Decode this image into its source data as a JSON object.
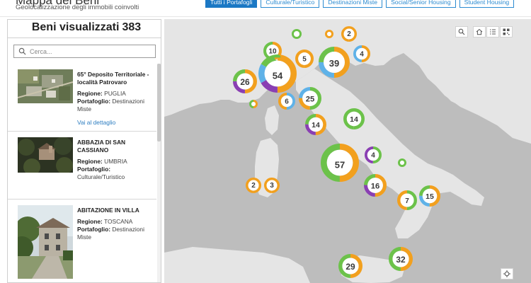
{
  "header": {
    "title": "Mappa dei Beni",
    "subtitle": "Geolocalizzazione degli immobili coinvolti"
  },
  "tabs": [
    {
      "label": "Tutti i Portafogli",
      "active": true
    },
    {
      "label": "Culturale/Turistico",
      "active": false
    },
    {
      "label": "Destinazioni Miste",
      "active": false
    },
    {
      "label": "Social/Senior Housing",
      "active": false
    },
    {
      "label": "Student Housing",
      "active": false
    }
  ],
  "sidebar": {
    "count_label": "Beni visualizzati",
    "count_value": "383",
    "search_placeholder": "Cerca...",
    "items": [
      {
        "title": "65° Deposito Territoriale - località Patrovaro",
        "region_label": "Regione:",
        "region_value": "PUGLIA",
        "portfolio_label": "Portafoglio:",
        "portfolio_value": "Destinazioni Miste",
        "link": "Vai al dettaglio"
      },
      {
        "title": "ABBAZIA DI SAN CASSIANO",
        "region_label": "Regione:",
        "region_value": "UMBRIA",
        "portfolio_label": "Portafoglio:",
        "portfolio_value": "Culturale/Turistico"
      },
      {
        "title": "ABITAZIONE IN VILLA",
        "region_label": "Regione:",
        "region_value": "TOSCANA",
        "portfolio_label": "Portafoglio:",
        "portfolio_value": "Destinazioni Miste"
      }
    ]
  },
  "map": {
    "clusters": [
      {
        "label": "10",
        "colors": [
          "#f2a01e",
          "#6cc24a"
        ]
      },
      {
        "label": "54",
        "colors": [
          "#f2a01e",
          "#8a3fb3",
          "#5fb2e8",
          "#6cc24a"
        ]
      },
      {
        "label": "5",
        "colors": [
          "#f2a01e",
          "#f2a01e"
        ]
      },
      {
        "label": "39",
        "colors": [
          "#f2a01e",
          "#5fb2e8",
          "#6cc24a"
        ]
      },
      {
        "label": "4",
        "colors": [
          "#f2a01e",
          "#5fb2e8"
        ]
      },
      {
        "label": "2",
        "colors": [
          "#f2a01e",
          "#f2a01e"
        ]
      },
      {
        "label": "26",
        "colors": [
          "#f2a01e",
          "#8a3fb3",
          "#6cc24a"
        ]
      },
      {
        "label": "6",
        "colors": [
          "#5fb2e8",
          "#f2a01e"
        ]
      },
      {
        "label": "25",
        "colors": [
          "#6cc24a",
          "#f2a01e",
          "#5fb2e8"
        ]
      },
      {
        "label": "14",
        "colors": [
          "#f2a01e",
          "#8a3fb3",
          "#6cc24a"
        ]
      },
      {
        "label": "14",
        "colors": [
          "#6cc24a",
          "#6cc24a"
        ]
      },
      {
        "label": "57",
        "colors": [
          "#f2a01e",
          "#6cc24a"
        ]
      },
      {
        "label": "4",
        "colors": [
          "#6cc24a",
          "#8a3fb3"
        ]
      },
      {
        "label": "16",
        "colors": [
          "#f2a01e",
          "#8a3fb3",
          "#6cc24a"
        ]
      },
      {
        "label": "2",
        "colors": [
          "#f2a01e",
          "#f2a01e"
        ]
      },
      {
        "label": "3",
        "colors": [
          "#f2a01e",
          "#f2a01e"
        ]
      },
      {
        "label": "7",
        "colors": [
          "#6cc24a",
          "#f2a01e"
        ]
      },
      {
        "label": "15",
        "colors": [
          "#f2a01e",
          "#5fb2e8",
          "#6cc24a"
        ]
      },
      {
        "label": "32",
        "colors": [
          "#f2a01e",
          "#6cc24a"
        ]
      },
      {
        "label": "29",
        "colors": [
          "#f2a01e",
          "#6cc24a"
        ]
      }
    ],
    "small_markers": [
      {
        "colors": [
          "#6cc24a"
        ]
      },
      {
        "colors": [
          "#f2a01e"
        ]
      },
      {
        "colors": [
          "#f2a01e",
          "#6cc24a"
        ]
      },
      {
        "colors": [
          "#6cc24a"
        ]
      }
    ],
    "controls": [
      "search-icon",
      "home-icon",
      "list-icon",
      "qr-icon",
      "locate-icon"
    ]
  }
}
